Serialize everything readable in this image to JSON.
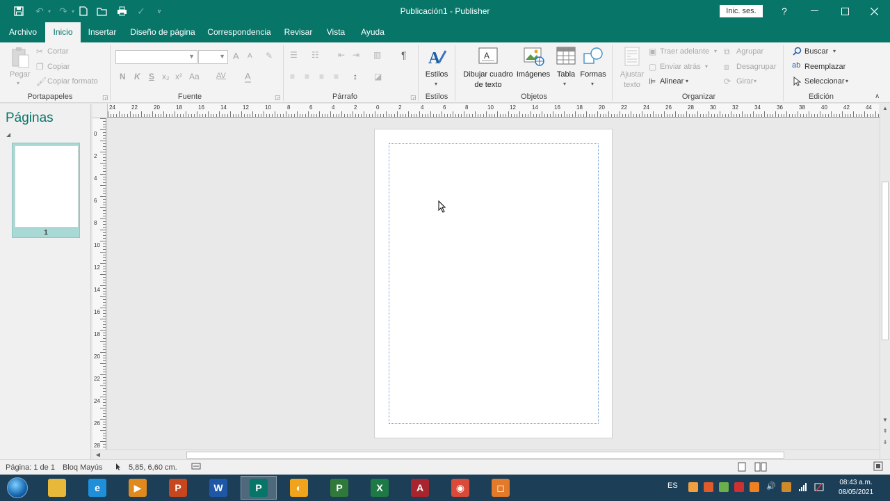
{
  "app": {
    "title": "Publicación1  -  Publisher",
    "sign_in": "Inic. ses.",
    "help": "?",
    "brand_color": "#077568"
  },
  "tabs": [
    "Archivo",
    "Inicio",
    "Insertar",
    "Diseño de página",
    "Correspondencia",
    "Revisar",
    "Vista",
    "Ayuda"
  ],
  "active_tab": "Inicio",
  "ribbon": {
    "clipboard": {
      "label": "Portapapeles",
      "paste": "Pegar",
      "cut": "Cortar",
      "copy": "Copiar",
      "format_painter": "Copiar formato"
    },
    "font": {
      "label": "Fuente",
      "bold": "N",
      "italic": "K",
      "underline": "S",
      "subscript": "x₂",
      "superscript": "x²",
      "case": "Aa",
      "spacing": "AV",
      "grow": "A",
      "shrink": "A",
      "color": "A"
    },
    "paragraph": {
      "label": "Párrafo",
      "pilcrow": "¶"
    },
    "styles": {
      "label": "Estilos",
      "button": "Estilos"
    },
    "objects": {
      "label": "Objetos",
      "draw_textbox_1": "Dibujar cuadro",
      "draw_textbox_2": "de texto",
      "images": "Imágenes",
      "table": "Tabla",
      "shapes": "Formas"
    },
    "arrange": {
      "label": "Organizar",
      "wrap_1": "Ajustar",
      "wrap_2": "texto",
      "bring_forward": "Traer adelante",
      "send_backward": "Enviar atrás",
      "align": "Alinear",
      "group": "Agrupar",
      "ungroup": "Desagrupar",
      "rotate": "Girar"
    },
    "editing": {
      "label": "Edición",
      "find": "Buscar",
      "replace": "Reemplazar",
      "select": "Seleccionar"
    }
  },
  "pages_pane": {
    "title": "Páginas",
    "thumb_number": "1"
  },
  "rulers": {
    "horizontal": [
      "24",
      "22",
      "20",
      "18",
      "16",
      "14",
      "12",
      "10",
      "8",
      "6",
      "4",
      "2",
      "0",
      "2",
      "4",
      "6",
      "8",
      "10",
      "12",
      "14",
      "16",
      "18",
      "20",
      "22",
      "24",
      "26",
      "28",
      "30",
      "32",
      "34",
      "36",
      "38",
      "40",
      "42",
      "44"
    ],
    "vertical": [
      "0",
      "2",
      "4",
      "6",
      "8",
      "10",
      "12",
      "14",
      "16",
      "18",
      "20",
      "22",
      "24",
      "26",
      "28"
    ]
  },
  "status": {
    "page": "Página: 1 de 1",
    "caps": "Bloq Mayús",
    "position": "5,85, 6,60 cm."
  },
  "taskbar": {
    "apps": [
      {
        "name": "explorer",
        "letter": "",
        "color": "#e8b83a"
      },
      {
        "name": "internet-explorer",
        "letter": "e",
        "color": "#1e8fd8"
      },
      {
        "name": "media-player",
        "letter": "▶",
        "color": "#e08a1e"
      },
      {
        "name": "powerpoint",
        "letter": "P",
        "color": "#c8461e"
      },
      {
        "name": "word",
        "letter": "W",
        "color": "#1f57a8"
      },
      {
        "name": "publisher",
        "letter": "P",
        "color": "#077568"
      },
      {
        "name": "vpn",
        "letter": "◐",
        "color": "#f1a31c"
      },
      {
        "name": "project",
        "letter": "P",
        "color": "#2f7a3a"
      },
      {
        "name": "excel",
        "letter": "X",
        "color": "#1e7a45"
      },
      {
        "name": "access",
        "letter": "A",
        "color": "#a8252e"
      },
      {
        "name": "chrome",
        "letter": "◉",
        "color": "#d94a38"
      },
      {
        "name": "screen-recorder",
        "letter": "◻",
        "color": "#e27a2a"
      }
    ],
    "lang": "ES",
    "time": "08:43 a.m.",
    "date": "08/05/2021"
  }
}
